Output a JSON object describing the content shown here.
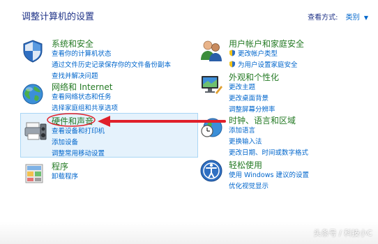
{
  "header": {
    "title": "调整计算机的设置",
    "view_by_label": "查看方式:",
    "view_by_value": "类别"
  },
  "categories": {
    "system": {
      "title": "系统和安全",
      "links": [
        "查看你的计算机状态",
        "通过文件历史记录保存你的文件备份副本",
        "查找并解决问题"
      ]
    },
    "network": {
      "title": "网络和 Internet",
      "links": [
        "查看网络状态和任务",
        "选择家庭组和共享选项"
      ]
    },
    "hardware": {
      "title": "硬件和声音",
      "links": [
        "查看设备和打印机",
        "添加设备",
        "调整常用移动设置"
      ]
    },
    "programs": {
      "title": "程序",
      "links": [
        "卸载程序"
      ]
    },
    "accounts": {
      "title": "用户帐户和家庭安全",
      "links": [
        "更改帐户类型",
        "为用户设置家庭安全"
      ]
    },
    "appearance": {
      "title": "外观和个性化",
      "links": [
        "更改主题",
        "更改桌面背景",
        "调整屏幕分辨率"
      ]
    },
    "clock": {
      "title": "时钟、语言和区域",
      "links": [
        "添加语言",
        "更换输入法",
        "更改日期、时间或数字格式"
      ]
    },
    "ease": {
      "title": "轻松使用",
      "links": [
        "使用 Windows 建议的设置",
        "优化视觉显示"
      ]
    }
  },
  "annotation": {
    "color": "#e0202a"
  },
  "watermark": "头条号 / 科技小C"
}
